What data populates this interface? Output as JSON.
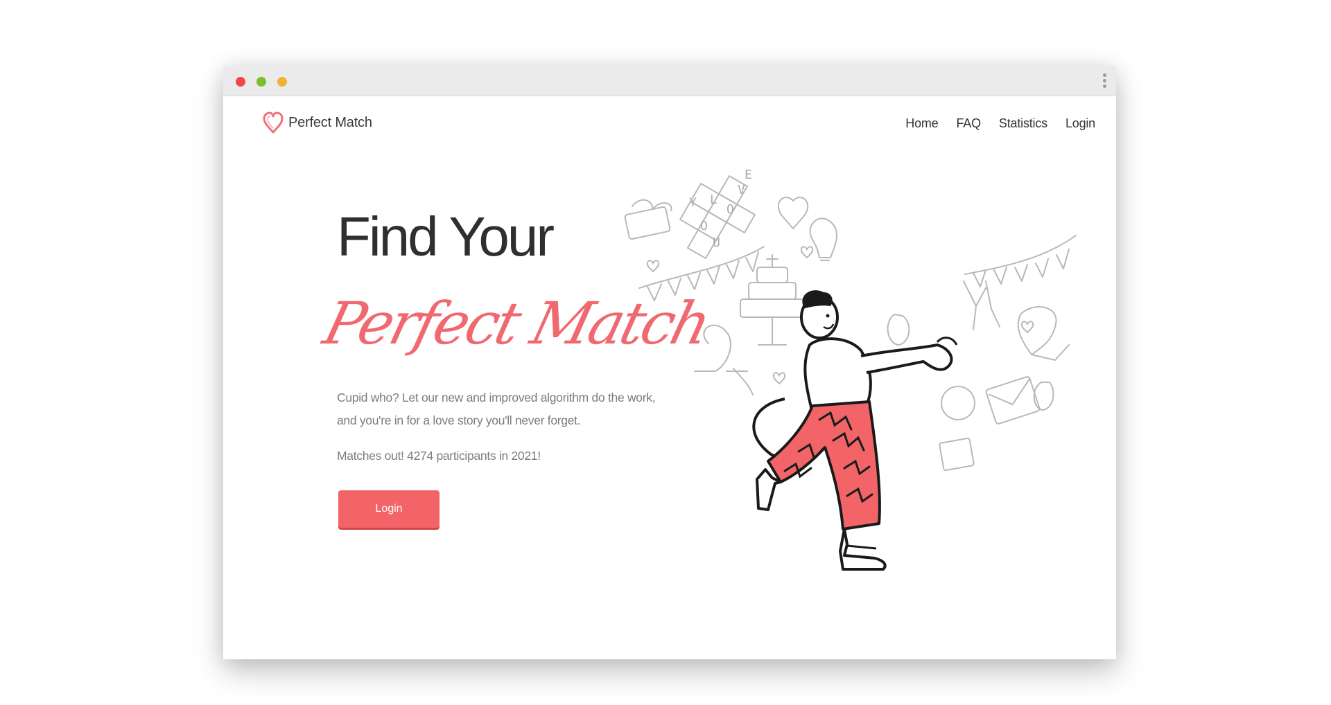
{
  "nav": {
    "brand": "Perfect Match",
    "links": [
      "Home",
      "FAQ",
      "Statistics",
      "Login"
    ]
  },
  "hero": {
    "headline": "Find Your",
    "script_title": "Perfect Match",
    "description": "Cupid who? Let our new and improved algorithm do the work, and you're in for a love story you'll never forget.",
    "stats_line": "Matches out! 4274 participants in 2021!",
    "cta_label": "Login"
  },
  "illustration": {
    "words": [
      "L",
      "O",
      "V",
      "E",
      "Y",
      "O",
      "U"
    ]
  },
  "colors": {
    "accent": "#f36468",
    "script": "#f06970",
    "text_dark": "#2f2f2f",
    "text_muted": "#7c7c7c",
    "titlebar": "#ebebeb",
    "traffic_red": "#f0474e",
    "traffic_green": "#7cbf2b",
    "traffic_yellow": "#f2b135"
  },
  "icons": [
    "heart-logo-icon",
    "kebab-menu-icon"
  ]
}
